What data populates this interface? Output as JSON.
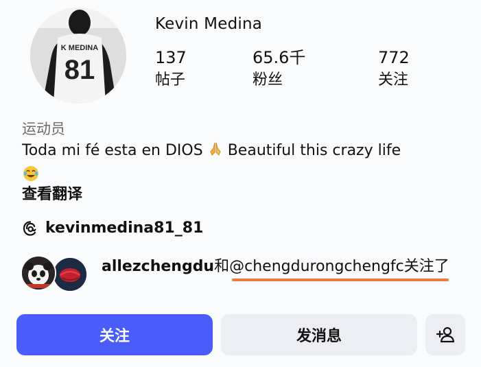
{
  "profile": {
    "name": "Kevin Medina",
    "jersey_name": "K MEDINA",
    "jersey_number": "81"
  },
  "stats": [
    {
      "value": "137",
      "label": "帖子"
    },
    {
      "value": "65.6千",
      "label": "粉丝"
    },
    {
      "value": "772",
      "label": "关注"
    }
  ],
  "category": "运动员",
  "bio": {
    "part1": "Toda mi fé esta en DIOS",
    "part2": "Beautiful this crazy life",
    "emoji_pray": "🙏",
    "emoji_laugh": "😂"
  },
  "translate_label": "查看翻译",
  "threads_handle": "kevinmedina81_81",
  "followed_by": {
    "user1": "allezchengdu",
    "joiner": "和",
    "mention": "@chengdurongchengfc",
    "suffix": "关注了"
  },
  "buttons": {
    "follow": "关注",
    "message": "发消息"
  },
  "colors": {
    "follow_button": "#4a5df9",
    "secondary_button": "#eceef3",
    "annotation_underline": "#f07a3a"
  }
}
